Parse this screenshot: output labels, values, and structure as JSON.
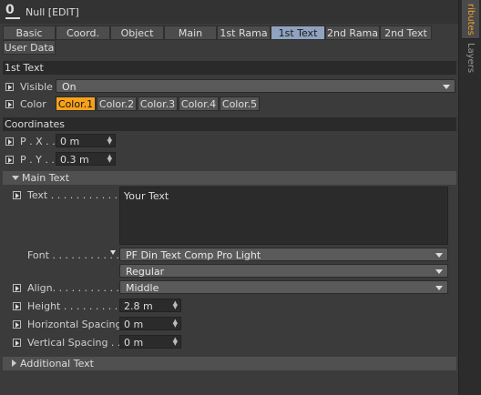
{
  "window": {
    "title": "Null [EDIT]"
  },
  "tabs": [
    {
      "label": "Basic"
    },
    {
      "label": "Coord."
    },
    {
      "label": "Object"
    },
    {
      "label": "Main"
    },
    {
      "label": "1st Rama"
    },
    {
      "label": "1st Text"
    },
    {
      "label": "2nd Rama"
    },
    {
      "label": "2nd Text"
    },
    {
      "label": "User Data"
    }
  ],
  "active_tab": "1st Text",
  "sections": {
    "first_text": "1st Text",
    "coordinates": "Coordinates",
    "main_text": "Main Text",
    "additional_text": "Additional Text"
  },
  "visible": {
    "label": "Visible",
    "value": "On"
  },
  "color": {
    "label": "Color",
    "options": [
      "Color.1",
      "Color.2",
      "Color.3",
      "Color.4",
      "Color.5"
    ],
    "selected": "Color.1"
  },
  "coords": {
    "px": {
      "label": "P . X . .",
      "value": "0 m"
    },
    "py": {
      "label": "P . Y . .",
      "value": "0.3 m"
    }
  },
  "main": {
    "text_label": "Text . . . . . . . . . . . .",
    "text_value": "Your Text",
    "font_label": "Font . . . . . . . . . . .",
    "font_value": "PF Din Text Comp Pro Light",
    "font_style": "Regular",
    "align_label": "Align. . . . . . . . . . . .",
    "align_value": "Middle",
    "height_label": "Height . . . . . . . . . .",
    "height_value": "2.8 m",
    "hspacing_label": "Horizontal Spacing",
    "hspacing_value": "0 m",
    "vspacing_label": "Vertical Spacing . .",
    "vspacing_value": "0 m"
  },
  "side_tabs": [
    "ributes",
    "Layers"
  ],
  "colors": {
    "accent": "#f6a21b",
    "active_tab": "#8fa3c0"
  }
}
